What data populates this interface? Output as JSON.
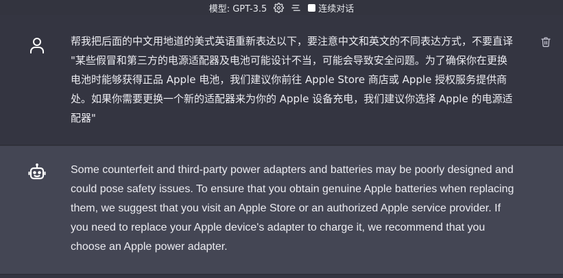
{
  "topbar": {
    "model_label": "模型: GPT-3.5",
    "continuous_label": "连续对话",
    "continuous_checked": false
  },
  "messages": [
    {
      "role": "user",
      "avatar_icon": "user-icon",
      "text": "帮我把后面的中文用地道的美式英语重新表达以下，要注意中文和英文的不同表达方式，不要直译 \"某些假冒和第三方的电源适配器及电池可能设计不当，可能会导致安全问题。为了确保你在更换电池时能够获得正品 Apple 电池，我们建议你前往 Apple Store 商店或 Apple 授权服务提供商处。如果你需要更换一个新的适配器来为你的 Apple 设备充电，我们建议你选择 Apple 的电源适配器\""
    },
    {
      "role": "assistant",
      "avatar_icon": "bot-icon",
      "text": "Some counterfeit and third-party power adapters and batteries may be poorly designed and could pose safety issues. To ensure that you obtain genuine Apple batteries when replacing them, we suggest that you visit an Apple Store or an authorized Apple service provider. If you need to replace your Apple device's adapter to charge it, we recommend that you choose an Apple power adapter."
    }
  ],
  "colors": {
    "user_bg": "#343541",
    "assistant_bg": "#444654",
    "text": "#ececf1"
  }
}
